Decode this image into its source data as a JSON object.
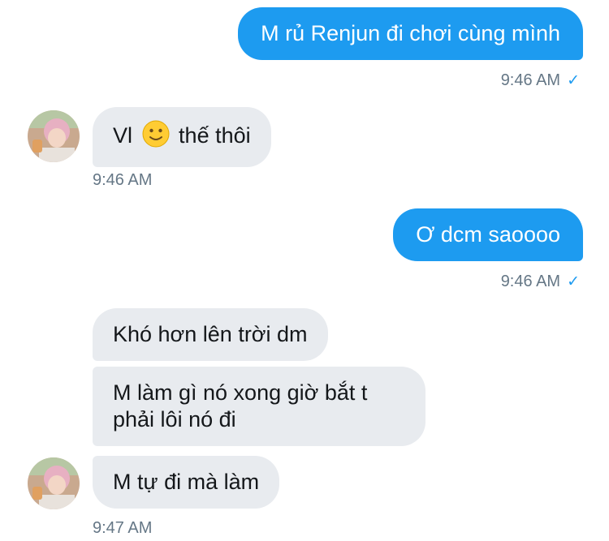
{
  "messages": [
    {
      "direction": "outgoing",
      "text": "M rủ Renjun đi chơi cùng mình",
      "time": "9:46 AM"
    },
    {
      "direction": "incoming",
      "text_before": "Vl",
      "emoji": "slightly-smiling-face",
      "text_after": "thế thôi",
      "time": "9:46 AM"
    },
    {
      "direction": "outgoing",
      "text": "Ơ dcm saoooo",
      "time": "9:46 AM"
    },
    {
      "direction": "incoming",
      "text": "Khó hơn lên trời dm"
    },
    {
      "direction": "incoming",
      "text": "M làm gì nó xong giờ bắt t phải lôi nó đi"
    },
    {
      "direction": "incoming",
      "text": "M tự đi mà làm",
      "time": "9:47 AM"
    }
  ],
  "icons": {
    "read_receipt": "checkmark-icon",
    "avatar": "user-avatar-photo"
  },
  "colors": {
    "outgoing_bubble": "#1d9bf0",
    "incoming_bubble": "#e8ebef",
    "timestamp": "#657786"
  }
}
